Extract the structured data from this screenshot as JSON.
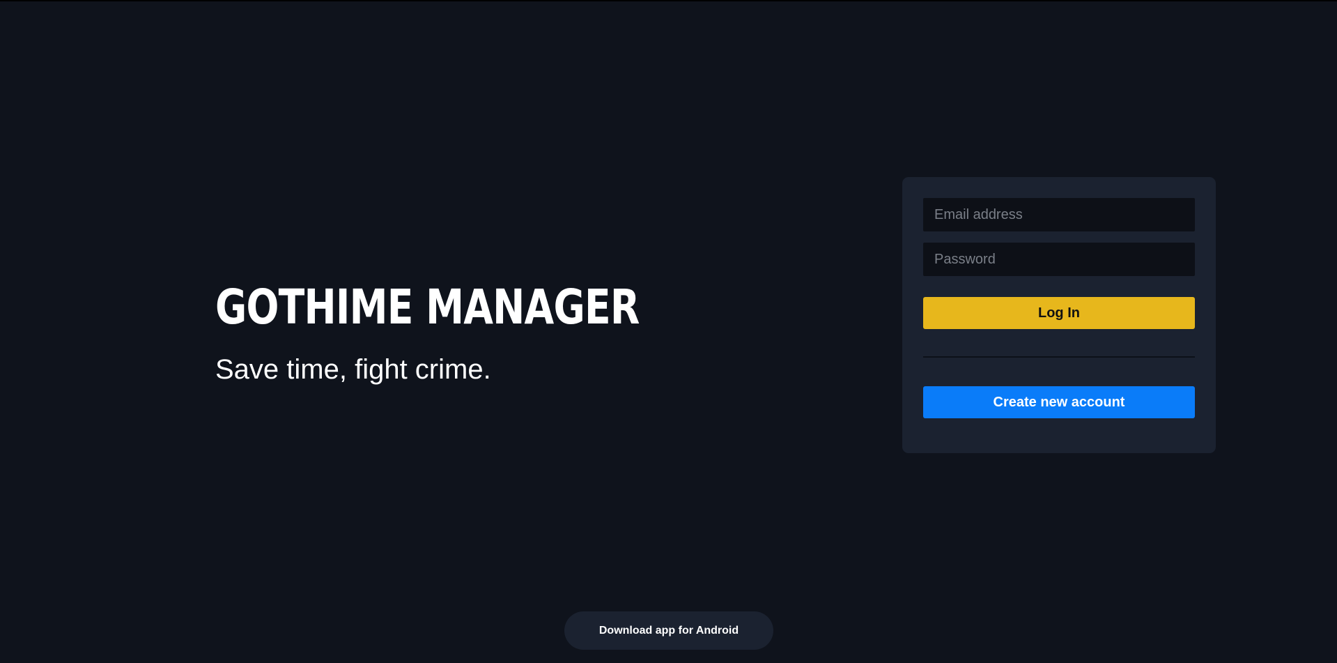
{
  "hero": {
    "title": "GOTHIME MANAGER",
    "subtitle": "Save time, fight crime."
  },
  "login_form": {
    "email": {
      "placeholder": "Email address",
      "value": ""
    },
    "password": {
      "placeholder": "Password",
      "value": ""
    },
    "login_label": "Log In",
    "create_account_label": "Create new account"
  },
  "footer": {
    "download_label": "Download app for Android"
  },
  "colors": {
    "background": "#0f131c",
    "card": "#1b2230",
    "login_button": "#e7b71c",
    "create_button": "#0a7cf9"
  }
}
